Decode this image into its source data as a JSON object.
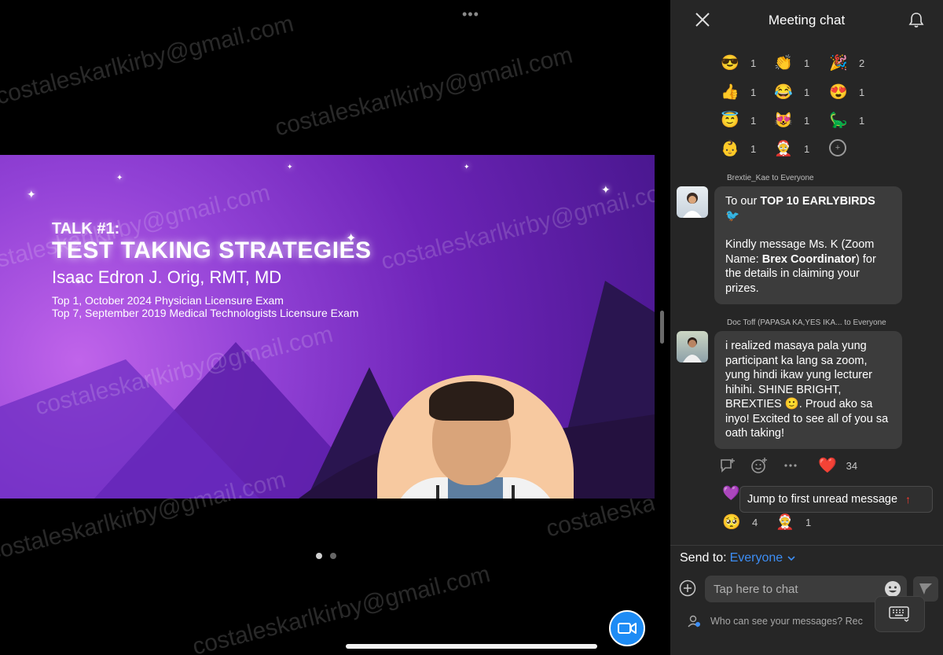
{
  "stage": {
    "top_handle": "•••",
    "watermark_text": "costaleskarlkirby@gmail.com",
    "slide": {
      "talk_number": "TALK #1:",
      "title": "TEST TAKING STRATEGIES",
      "speaker": "Isaac Edron J. Orig, RMT, MD",
      "credits": [
        "Top 1, October 2024 Physician Licensure Exam",
        "Top 7, September 2019 Medical Technologists Licensure Exam"
      ]
    },
    "page_count": 2,
    "active_page": 1,
    "colors": {
      "slide_accent": "#9242d6",
      "video_button": "#1e8cf5"
    }
  },
  "chat": {
    "title": "Meeting chat",
    "reactions": [
      [
        {
          "emoji": "😎",
          "count": "1"
        },
        {
          "emoji": "👏",
          "count": "1"
        },
        {
          "emoji": "🎉",
          "count": "2"
        }
      ],
      [
        {
          "emoji": "👍",
          "count": "1"
        },
        {
          "emoji": "😂",
          "count": "1"
        },
        {
          "emoji": "😍",
          "count": "1"
        }
      ],
      [
        {
          "emoji": "😇",
          "count": "1"
        },
        {
          "emoji": "😻",
          "count": "1"
        },
        {
          "emoji": "🦕",
          "count": "1"
        }
      ],
      [
        {
          "emoji": "👶",
          "count": "1"
        },
        {
          "emoji": "🤶",
          "count": "1"
        }
      ]
    ],
    "messages": [
      {
        "sender": "Brextie_Kae to Everyone",
        "line1_prefix": "To our ",
        "line1_bold": "TOP 10 EARLYBIRDS",
        "line1_emoji": "🐦",
        "line2_prefix": "Kindly message Ms. K (Zoom Name: ",
        "line2_bold": "Brex Coordinator",
        "line2_suffix": ") for the details in claiming your prizes."
      },
      {
        "sender": "Doc Toff (PAPASA KA,YES IKA... to Everyone",
        "text": "i realized masaya pala yung participant ka lang sa zoom, yung hindi ikaw yung lecturer hihihi. SHINE BRIGHT, BREXTIES 🙂. Proud ako sa inyo! Excited to see all of you sa oath taking!",
        "heart": "❤️",
        "heart_count": "34"
      }
    ],
    "purple_heart": "💜",
    "jump_label": "Jump to first unread message",
    "jump_arrow": "↑",
    "bottom_reactions": [
      {
        "emoji": "🥺",
        "count": "4"
      },
      {
        "emoji": "🤶",
        "count": "1"
      }
    ],
    "send_to_label": "Send to:",
    "send_to_target": "Everyone",
    "input_placeholder": "Tap here to chat",
    "privacy_text": "Who can see your messages? Rec",
    "colors": {
      "panel_bg": "#262626",
      "bubble_bg": "#3c3c3c",
      "link_blue": "#3d8ef5",
      "alert_red": "#ff3b30"
    }
  }
}
